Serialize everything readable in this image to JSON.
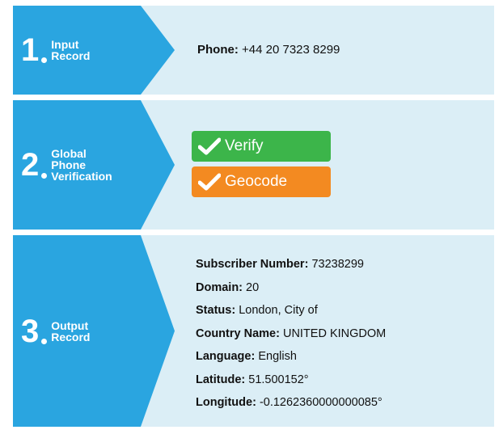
{
  "steps": [
    {
      "number": "1",
      "label_lines": [
        "Input",
        "Record"
      ]
    },
    {
      "number": "2",
      "label_lines": [
        "Global",
        "Phone",
        "Verification"
      ]
    },
    {
      "number": "3",
      "label_lines": [
        "Output",
        "Record"
      ]
    }
  ],
  "input": {
    "key": "Phone:",
    "value": "+44 20 7323 8299"
  },
  "actions": {
    "verify_label": "Verify",
    "geocode_label": "Geocode",
    "verify_color": "#3cb54a",
    "geocode_color": "#f38a21",
    "icon": "checkmark-icon"
  },
  "output": [
    {
      "key": "Subscriber Number:",
      "value": "73238299"
    },
    {
      "key": "Domain:",
      "value": "20"
    },
    {
      "key": "Status:",
      "value": "London, City of"
    },
    {
      "key": "Country Name:",
      "value": "UNITED KINGDOM"
    },
    {
      "key": "Language:",
      "value": "English"
    },
    {
      "key": "Latitude:",
      "value": "51.500152°"
    },
    {
      "key": "Longitude:",
      "value": "-0.1262360000000085°"
    }
  ],
  "colors": {
    "step_blue": "#2aa5e0",
    "panel_bg": "#dbeef6"
  }
}
